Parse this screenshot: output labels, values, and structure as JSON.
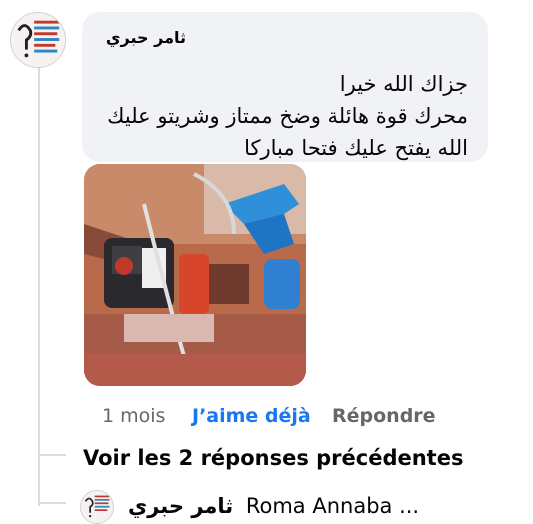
{
  "comment": {
    "author": "ثامر حبري",
    "lines": [
      "جزاك الله خيرا",
      "محرك قوة هائلة وضخ ممتاز وشريتو عليك",
      "الله يفتح عليك فتحا مباركا"
    ],
    "timestamp": "1 mois",
    "like_label": "J’aime déjà",
    "reply_label": "Répondre"
  },
  "thread": {
    "view_previous_label": "Voir les 2 réponses précédentes"
  },
  "reply_preview": {
    "author": "ثامر حبري",
    "text": "Roma Annaba ..."
  },
  "colors": {
    "bubble": "#f0f2f5",
    "link_blue": "#1877f2",
    "muted": "#65676b",
    "thread_line": "#d9dbdf"
  }
}
